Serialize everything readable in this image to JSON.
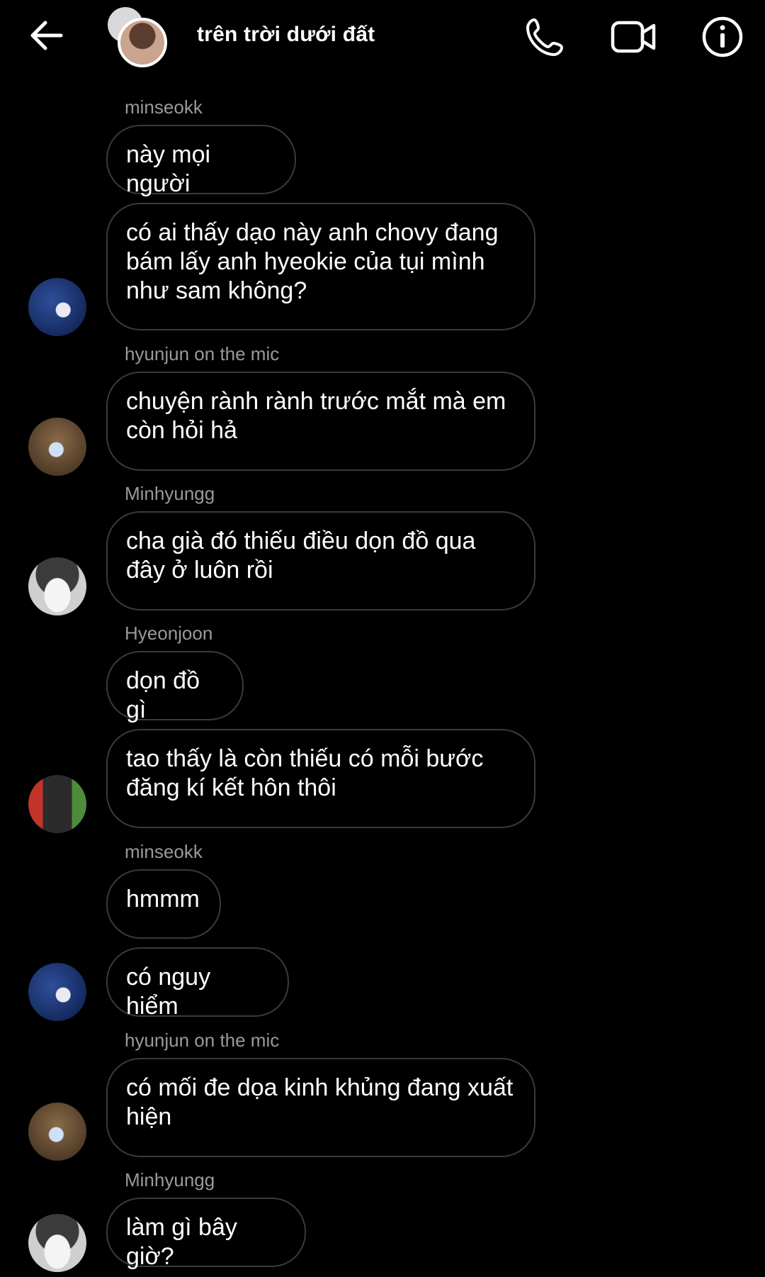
{
  "header": {
    "title": "trên trời dưới đất",
    "icons": [
      "back-arrow-icon",
      "group-avatar",
      "phone-icon",
      "video-call-icon",
      "info-icon"
    ]
  },
  "messages": [
    {
      "sender": "minseokk",
      "text": "này mọi người"
    },
    {
      "text_lines": [
        "có ai thấy dạo này anh chovy đang",
        "bám lấy anh hyeokie của tụi mình",
        "như sam không?"
      ]
    },
    {
      "sender": "hyunjun on the mic",
      "text_lines": [
        "chuyện rành rành trước mắt mà em",
        "còn hỏi hả"
      ]
    },
    {
      "sender": "Minhyungg",
      "text_lines": [
        "cha già đó thiếu điều dọn đồ qua",
        "đây ở luôn rồi"
      ]
    },
    {
      "sender": "Hyeonjoon",
      "text": "dọn đồ gì"
    },
    {
      "text_lines": [
        "tao thấy là còn thiếu có mỗi bước",
        "đăng kí kết hôn thôi"
      ]
    },
    {
      "sender": "minseokk",
      "text": "hmmm"
    },
    {
      "text": "có nguy hiểm"
    },
    {
      "sender": "hyunjun on the mic",
      "text_lines": [
        "có mối đe dọa kinh khủng đang xuất",
        "hiện"
      ]
    },
    {
      "sender": "Minhyungg",
      "text": "làm gì bây giờ?"
    }
  ]
}
